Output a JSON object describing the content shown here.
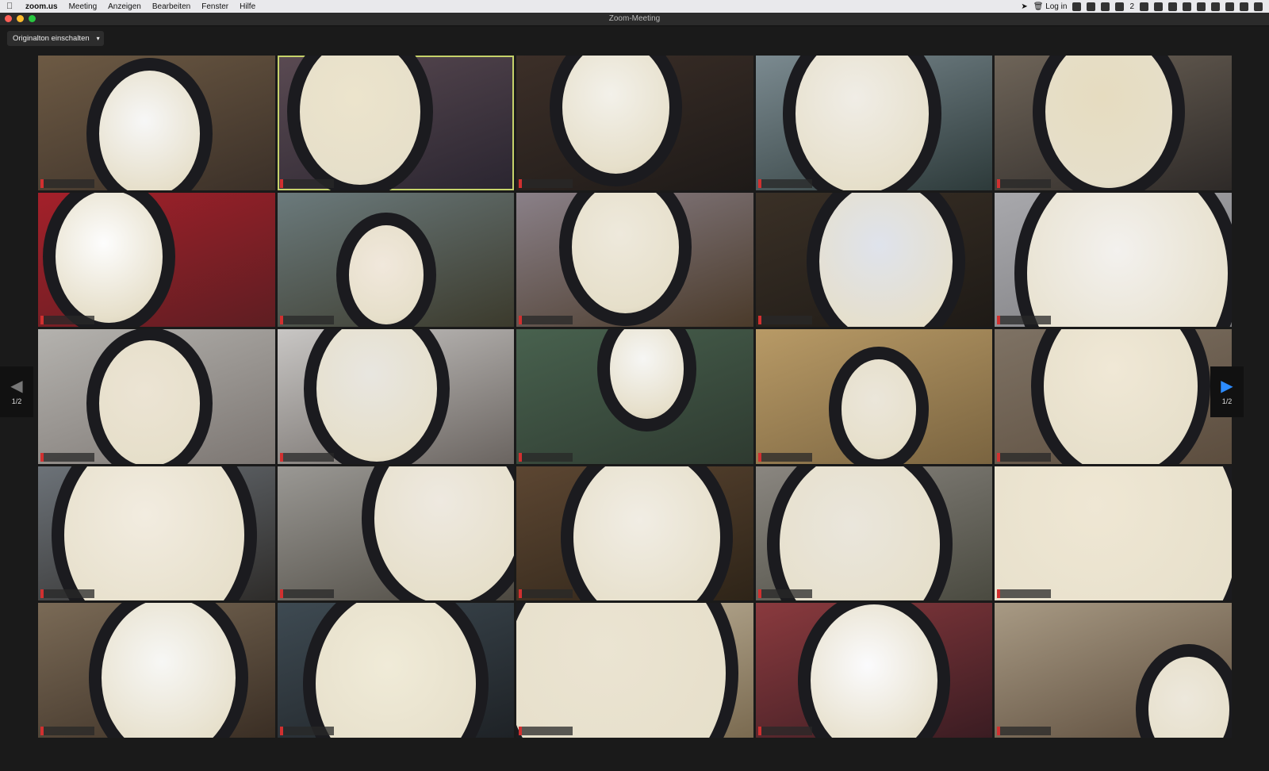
{
  "menubar": {
    "app_name": "zoom.us",
    "items": [
      "Meeting",
      "Anzeigen",
      "Bearbeiten",
      "Fenster",
      "Hilfe"
    ],
    "login": "Log in",
    "badge_count": "2"
  },
  "window": {
    "title": "Zoom-Meeting"
  },
  "toolbar": {
    "original_audio_label": "Originalton einschalten",
    "dropdown_glyph": "▾"
  },
  "gallery": {
    "page_indicator": "1/2",
    "prev_glyph": "◀",
    "next_glyph": "▶",
    "active_tile": 2,
    "tile_count": 25
  },
  "colors": {
    "active_speaker_border": "#c6d26a",
    "accent_blue": "#2d8cff"
  }
}
